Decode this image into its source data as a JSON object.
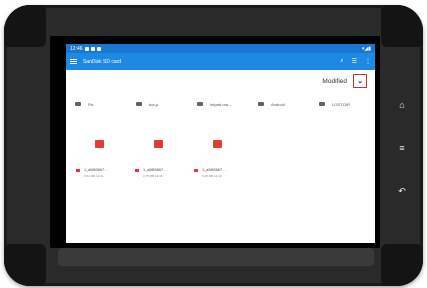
{
  "status": {
    "time": "12:46"
  },
  "appbar": {
    "title": "SanDisk SD card"
  },
  "sort": {
    "label": "Modified",
    "chevron": "⌄"
  },
  "folders": [
    {
      "label": "Pic"
    },
    {
      "label": "bot-p"
    },
    {
      "label": "Intpad-ma…"
    },
    {
      "label": "Android"
    },
    {
      "label": "LOST.DIR"
    }
  ],
  "files": [
    {
      "name": "1_a5f83667…",
      "meta": "0.52 MB  12:41"
    },
    {
      "name": "1_a5f83667…",
      "meta": "0.75 MB  12:41"
    },
    {
      "name": "1_a5f83667…",
      "meta": "0.25 MB  12:40"
    }
  ],
  "navkeys": {
    "home": "⌂",
    "menu": "≡",
    "back": "↶"
  },
  "colors": {
    "statusbar": "#1976d2",
    "appbar": "#1e88e5",
    "file_icon": "#e53935",
    "sort_highlight": "#d32f2f"
  }
}
